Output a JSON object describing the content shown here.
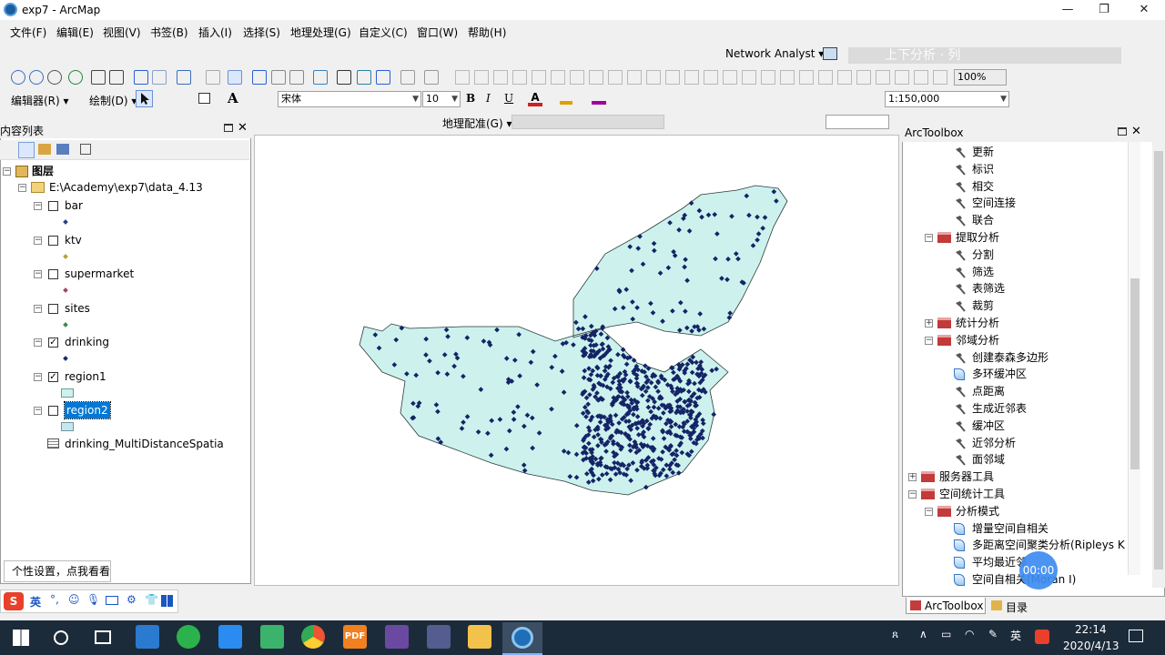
{
  "window": {
    "title": "exp7 - ArcMap"
  },
  "menu": [
    "文件(F)",
    "编辑(E)",
    "视图(V)",
    "书签(B)",
    "插入(I)",
    "选择(S)",
    "地理处理(G)",
    "自定义(C)",
    "窗口(W)",
    "帮助(H)"
  ],
  "toolbar": {
    "network_analyst": "Network Analyst ▾",
    "overlay_text": "上下分析 · 列",
    "zoom_pct": "100%",
    "editor": "编辑器(R) ▾",
    "draw": "绘制(D) ▾",
    "font": "宋体",
    "fontsize": "10",
    "scale": "1:150,000",
    "georef": "地理配准(G) ▾",
    "bold": "B",
    "italic": "I",
    "underline": "U"
  },
  "toc": {
    "title": "内容列表",
    "root": "图层",
    "folder": "E:\\Academy\\exp7\\data_4.13",
    "layers": [
      {
        "name": "bar",
        "checked": false,
        "color": "#2c3f86"
      },
      {
        "name": "ktv",
        "checked": false,
        "color": "#b5a23a"
      },
      {
        "name": "supermarket",
        "checked": false,
        "color": "#a2456a"
      },
      {
        "name": "sites",
        "checked": false,
        "color": "#3a8c4a"
      },
      {
        "name": "drinking",
        "checked": true,
        "color": "#1a2a6a"
      },
      {
        "name": "region1",
        "checked": true,
        "color": "#cdf2ee"
      },
      {
        "name": "region2",
        "checked": false,
        "color": "#c9e6f0"
      }
    ],
    "table": "drinking_MultiDistanceSpatia",
    "check_mark": "✓"
  },
  "arctoolbox": {
    "title": "ArcToolbox",
    "items": [
      {
        "label": "更新",
        "type": "tool",
        "indent": 3
      },
      {
        "label": "标识",
        "type": "tool",
        "indent": 3
      },
      {
        "label": "相交",
        "type": "tool",
        "indent": 3
      },
      {
        "label": "空间连接",
        "type": "tool",
        "indent": 3
      },
      {
        "label": "联合",
        "type": "tool",
        "indent": 3
      },
      {
        "label": "提取分析",
        "type": "toolset",
        "indent": 2,
        "exp": "−"
      },
      {
        "label": "分割",
        "type": "tool",
        "indent": 3
      },
      {
        "label": "筛选",
        "type": "tool",
        "indent": 3
      },
      {
        "label": "表筛选",
        "type": "tool",
        "indent": 3
      },
      {
        "label": "裁剪",
        "type": "tool",
        "indent": 3
      },
      {
        "label": "统计分析",
        "type": "toolset",
        "indent": 2,
        "exp": "+"
      },
      {
        "label": "邻域分析",
        "type": "toolset",
        "indent": 2,
        "exp": "−"
      },
      {
        "label": "创建泰森多边形",
        "type": "tool",
        "indent": 3
      },
      {
        "label": "多环缓冲区",
        "type": "script",
        "indent": 3
      },
      {
        "label": "点距离",
        "type": "tool",
        "indent": 3
      },
      {
        "label": "生成近邻表",
        "type": "tool",
        "indent": 3
      },
      {
        "label": "缓冲区",
        "type": "tool",
        "indent": 3
      },
      {
        "label": "近邻分析",
        "type": "tool",
        "indent": 3
      },
      {
        "label": "面邻域",
        "type": "tool",
        "indent": 3
      },
      {
        "label": "服务器工具",
        "type": "toolbox",
        "indent": 1,
        "exp": "+"
      },
      {
        "label": "空间统计工具",
        "type": "toolbox",
        "indent": 1,
        "exp": "−"
      },
      {
        "label": "分析模式",
        "type": "toolset",
        "indent": 2,
        "exp": "−"
      },
      {
        "label": "增量空间自相关",
        "type": "script",
        "indent": 3
      },
      {
        "label": "多距离空间聚类分析(Ripleys K 函",
        "type": "script",
        "indent": 3
      },
      {
        "label": "平均最近邻",
        "type": "script",
        "indent": 3
      },
      {
        "label": "空间自相关(Moran I)",
        "type": "script",
        "indent": 3
      }
    ],
    "tabs": [
      "ArcToolbox",
      "目录"
    ]
  },
  "tooltip": "个性设置，点我看看",
  "timer": "00:00",
  "ime": {
    "lang": "英",
    "label": "S"
  },
  "taskbar": {
    "time": "22:14",
    "date": "2020/4/13",
    "lang": "英"
  },
  "colors": {
    "accent": "#0078d7",
    "polygon_fill": "#cdf2ee",
    "point": "#142466"
  }
}
